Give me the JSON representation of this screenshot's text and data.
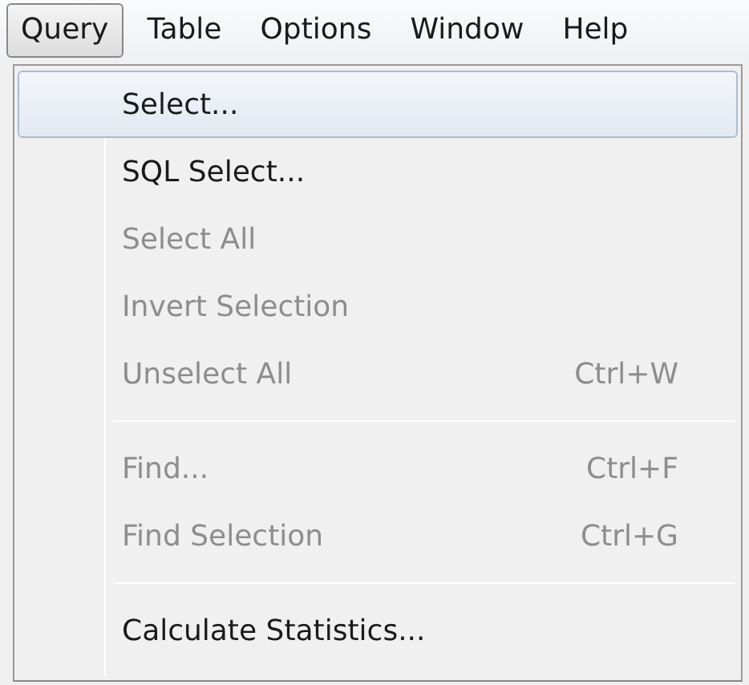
{
  "menubar": [
    {
      "label": "Query",
      "selected": true
    },
    {
      "label": "Table",
      "selected": false
    },
    {
      "label": "Options",
      "selected": false
    },
    {
      "label": "Window",
      "selected": false
    },
    {
      "label": "Help",
      "selected": false
    }
  ],
  "menu": {
    "items": [
      {
        "kind": "item",
        "label": "Select...",
        "disabled": false,
        "selected": true
      },
      {
        "kind": "item",
        "label": "SQL Select...",
        "disabled": false,
        "selected": false
      },
      {
        "kind": "item",
        "label": "Select All",
        "disabled": true,
        "selected": false
      },
      {
        "kind": "item",
        "label": "Invert Selection",
        "disabled": true,
        "selected": false
      },
      {
        "kind": "item",
        "label": "Unselect All",
        "shortcut": "Ctrl+W",
        "disabled": true,
        "selected": false
      },
      {
        "kind": "separator"
      },
      {
        "kind": "item",
        "label": "Find...",
        "shortcut": "Ctrl+F",
        "disabled": true,
        "selected": false
      },
      {
        "kind": "item",
        "label": "Find Selection",
        "shortcut": "Ctrl+G",
        "disabled": true,
        "selected": false
      },
      {
        "kind": "separator"
      },
      {
        "kind": "item",
        "label": "Calculate Statistics...",
        "disabled": false,
        "selected": false
      }
    ]
  }
}
